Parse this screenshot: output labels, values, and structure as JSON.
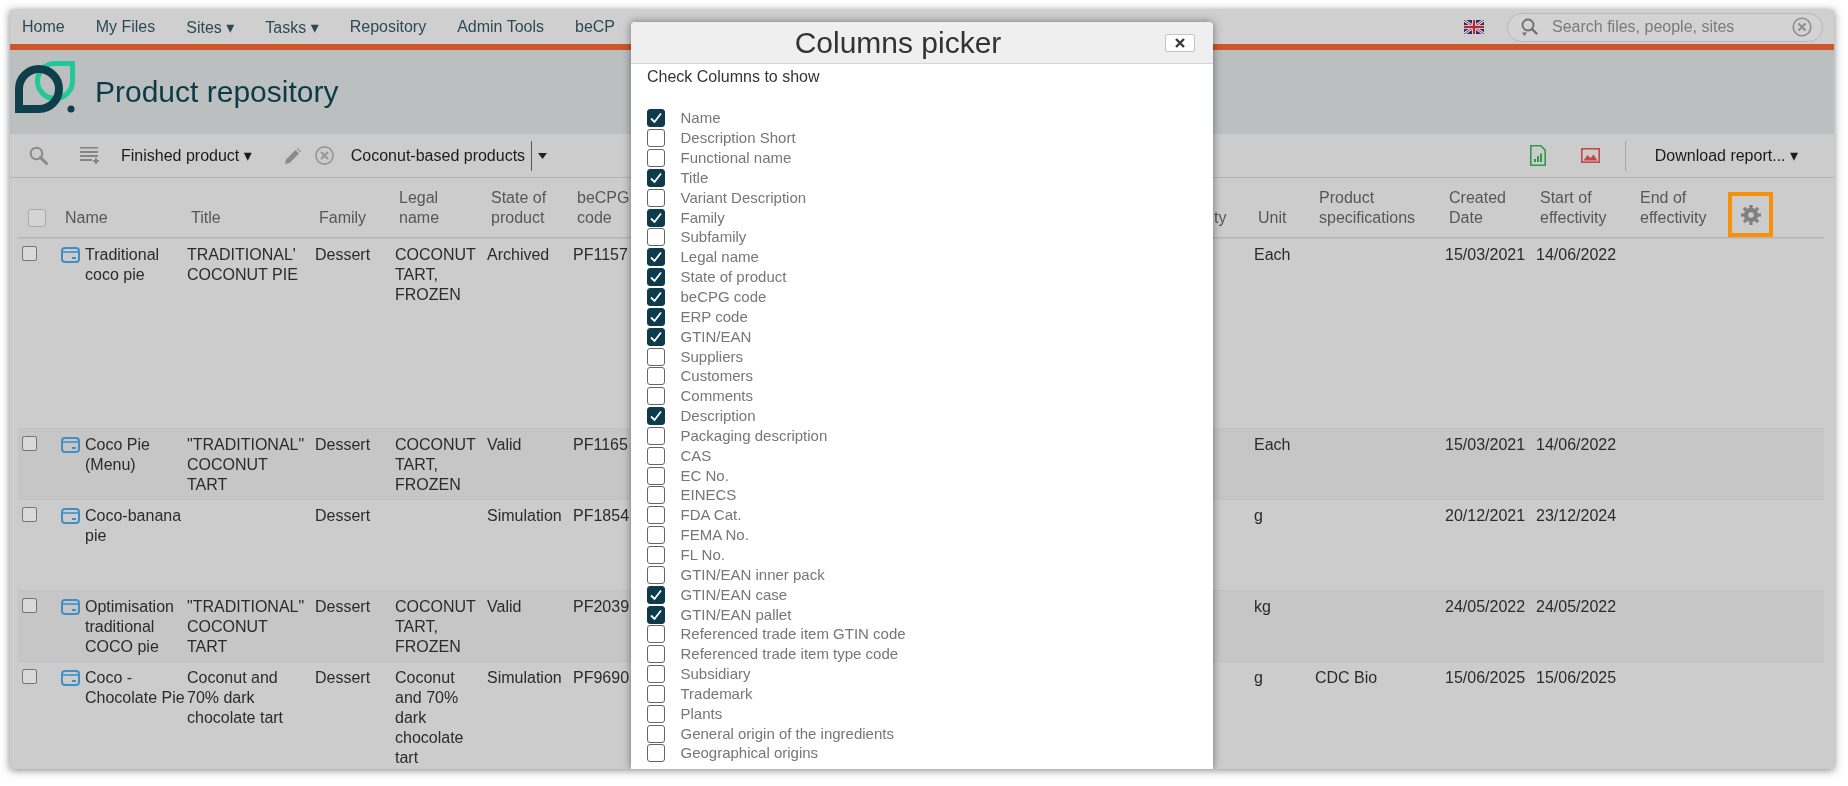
{
  "nav": {
    "items": [
      {
        "label": "Home"
      },
      {
        "label": "My Files"
      },
      {
        "label": "Sites ▾"
      },
      {
        "label": "Tasks ▾"
      },
      {
        "label": "Repository"
      },
      {
        "label": "Admin Tools"
      },
      {
        "label": "beCP"
      }
    ],
    "search": {
      "placeholder": "Search files, people, sites"
    }
  },
  "page_header": {
    "title": "Product repository"
  },
  "toolbar": {
    "product_type": "Finished product ▾",
    "saved_search": "Coconut-based products",
    "download_report": "Download report... ▾"
  },
  "table": {
    "select_all": {
      "checked": false
    },
    "left_columns": [
      {
        "label": "Name"
      },
      {
        "label": "Title"
      },
      {
        "label": "Family"
      },
      {
        "label": "Legal name"
      },
      {
        "label": "State of product"
      },
      {
        "label": "beCPG code"
      }
    ],
    "right_columns": [
      {
        "label": "ty"
      },
      {
        "label": "Unit"
      },
      {
        "label": "Product specifications"
      },
      {
        "label": "Created Date"
      },
      {
        "label": "Start of effectivity"
      },
      {
        "label": "End of effectivity"
      }
    ],
    "settings_button": {
      "highlighted": true
    },
    "rows": [
      {
        "checked": false,
        "name": "Traditional coco pie",
        "title": "TRADITIONAL' COCONUT PIE",
        "family": "Dessert",
        "legal_name": "COCONUT TART, FROZEN",
        "state": "Archived",
        "code": "PF1157",
        "unit": "Each",
        "created": "15/03/2021",
        "start": "14/06/2022"
      },
      {
        "checked": false,
        "name": "Coco Pie (Menu)",
        "title": "\"TRADITIONAL\" COCONUT TART",
        "family": "Dessert",
        "legal_name": "COCONUT TART, FROZEN",
        "state": "Valid",
        "code": "PF1165",
        "unit": "Each",
        "created": "15/03/2021",
        "start": "14/06/2022"
      },
      {
        "checked": false,
        "name": "Coco-banana pie",
        "family": "Dessert",
        "state": "Simulation",
        "code": "PF1854",
        "unit": "g",
        "created": "20/12/2021",
        "start": "23/12/2024"
      },
      {
        "checked": false,
        "name": "Optimisation traditional COCO pie",
        "title": "\"TRADITIONAL\" COCONUT TART",
        "family": "Dessert",
        "legal_name": "COCONUT TART, FROZEN",
        "state": "Valid",
        "code": "PF2039",
        "unit": "kg",
        "created": "24/05/2022",
        "start": "24/05/2022"
      },
      {
        "checked": false,
        "name": "Coco - Chocolate Pie",
        "title": "Coconut and 70% dark chocolate tart",
        "family": "Dessert",
        "legal_name": "Coconut and 70% dark chocolate tart",
        "state": "Simulation",
        "code": "PF9690",
        "unit": "g",
        "specifications": "CDC Bio",
        "created": "15/06/2025",
        "start": "15/06/2025"
      }
    ]
  },
  "dialog": {
    "title": "Columns picker",
    "instruction": "Check Columns to show",
    "options": [
      {
        "label": "Name",
        "checked": true
      },
      {
        "label": "Description Short",
        "checked": false
      },
      {
        "label": "Functional name",
        "checked": false
      },
      {
        "label": "Title",
        "checked": true
      },
      {
        "label": "Variant Description",
        "checked": false
      },
      {
        "label": "Family",
        "checked": true
      },
      {
        "label": "Subfamily",
        "checked": false
      },
      {
        "label": "Legal name",
        "checked": true
      },
      {
        "label": "State of product",
        "checked": true
      },
      {
        "label": "beCPG code",
        "checked": true
      },
      {
        "label": "ERP code",
        "checked": true
      },
      {
        "label": "GTIN/EAN",
        "checked": true
      },
      {
        "label": "Suppliers",
        "checked": false
      },
      {
        "label": "Customers",
        "checked": false
      },
      {
        "label": "Comments",
        "checked": false
      },
      {
        "label": "Description",
        "checked": true
      },
      {
        "label": "Packaging description",
        "checked": false
      },
      {
        "label": "CAS",
        "checked": false
      },
      {
        "label": "EC No.",
        "checked": false
      },
      {
        "label": "EINECS",
        "checked": false
      },
      {
        "label": "FDA Cat.",
        "checked": false
      },
      {
        "label": "FEMA No.",
        "checked": false
      },
      {
        "label": "FL No.",
        "checked": false
      },
      {
        "label": "GTIN/EAN inner pack",
        "checked": false
      },
      {
        "label": "GTIN/EAN case",
        "checked": true
      },
      {
        "label": "GTIN/EAN pallet",
        "checked": true
      },
      {
        "label": "Referenced trade item GTIN code",
        "checked": false
      },
      {
        "label": "Referenced trade item type code",
        "checked": false
      },
      {
        "label": "Subsidiary",
        "checked": false
      },
      {
        "label": "Trademark",
        "checked": false
      },
      {
        "label": "Plants",
        "checked": false
      },
      {
        "label": "General origin of the ingredients",
        "checked": false
      },
      {
        "label": "Geographical origins",
        "checked": false
      }
    ]
  }
}
